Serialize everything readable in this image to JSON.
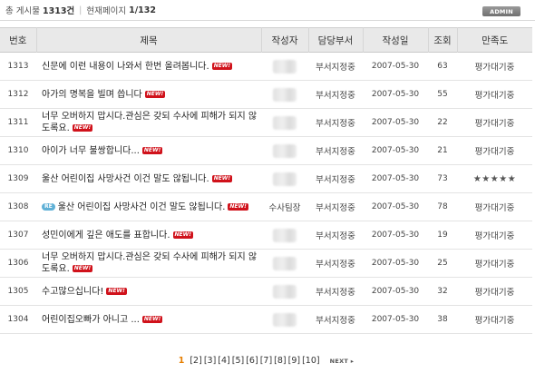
{
  "summary": {
    "total_label": "총 게시물",
    "total_count": "1313건",
    "page_label": "현재페이지",
    "page_value": "1/132",
    "admin_label": "ADMIN"
  },
  "columns": [
    "번호",
    "제목",
    "작성자",
    "담당부서",
    "작성일",
    "조회",
    "만족도"
  ],
  "rows": [
    {
      "num": "1313",
      "title": "신문에 이런 내용이 나와서 한번 올려봅니다.",
      "new": "NEW!",
      "dept": "부서지정중",
      "date": "2007-05-30",
      "views": "63",
      "rating": "평가대기중"
    },
    {
      "num": "1312",
      "title": "아가의 명복을 빌며 씁니다",
      "new": "NEW!",
      "dept": "부서지정중",
      "date": "2007-05-30",
      "views": "55",
      "rating": "평가대기중"
    },
    {
      "num": "1311",
      "title": "너무 오버하지 맙시다.관심은 갖되 수사에 피해가 되지 않도록요.",
      "new": "NEW!",
      "dept": "부서지정중",
      "date": "2007-05-30",
      "views": "22",
      "rating": "평가대기중"
    },
    {
      "num": "1310",
      "title": "아이가 너무 불쌍합니다...",
      "new": "NEW!",
      "dept": "부서지정중",
      "date": "2007-05-30",
      "views": "21",
      "rating": "평가대기중"
    },
    {
      "num": "1309",
      "title": "울산 어린이집 사망사건 이건 말도 않됩니다.",
      "new": "NEW!",
      "dept": "부서지정중",
      "date": "2007-05-30",
      "views": "73",
      "rating": "★★★★★"
    },
    {
      "num": "1308",
      "title": "울산 어린이집 사망사건 이건 말도 않됩니다.",
      "re": "RE",
      "new": "NEW!",
      "author": "수사팀장",
      "dept": "부서지정중",
      "date": "2007-05-30",
      "views": "78",
      "rating": "평가대기중"
    },
    {
      "num": "1307",
      "title": "성민이에게 깊은 애도를 표합니다.",
      "new": "NEW!",
      "dept": "부서지정중",
      "date": "2007-05-30",
      "views": "19",
      "rating": "평가대기중"
    },
    {
      "num": "1306",
      "title": "너무 오버하지 맙시다.관심은 갖되 수사에 피해가 되지 않도록요.",
      "new": "NEW!",
      "dept": "부서지정중",
      "date": "2007-05-30",
      "views": "25",
      "rating": "평가대기중"
    },
    {
      "num": "1305",
      "title": "수고많으십니다!",
      "new": "NEW!",
      "dept": "부서지정중",
      "date": "2007-05-30",
      "views": "32",
      "rating": "평가대기중"
    },
    {
      "num": "1304",
      "title": "어린이집오빠가 아니고 ...",
      "new": "NEW!",
      "dept": "부서지정중",
      "date": "2007-05-30",
      "views": "38",
      "rating": "평가대기중"
    }
  ],
  "pagination": {
    "current": "1",
    "pages": [
      "[2]",
      "[3]",
      "[4]",
      "[5]",
      "[6]",
      "[7]",
      "[8]",
      "[9]",
      "[10]"
    ],
    "next_label": "NEXT ▸"
  }
}
